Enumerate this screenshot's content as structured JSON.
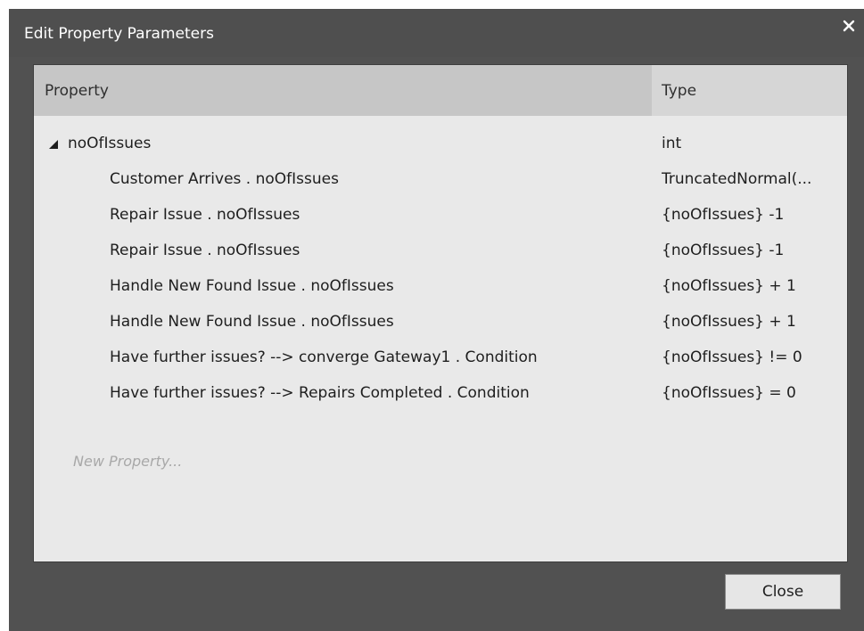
{
  "window": {
    "title": "Edit Property Parameters",
    "close_icon": "close-icon"
  },
  "grid": {
    "columns": {
      "property": "Property",
      "type": "Type"
    },
    "parent_row": {
      "property": "noOfIssues",
      "type": "int",
      "expander_icon": "collapse-triangle-icon",
      "expanded": true
    },
    "rows": [
      {
        "property": "Customer Arrives . noOfIssues",
        "type": "TruncatedNormal(..."
      },
      {
        "property": "Repair Issue . noOfIssues",
        "type": "{noOfIssues} -1"
      },
      {
        "property": "Repair Issue . noOfIssues",
        "type": "{noOfIssues} -1"
      },
      {
        "property": "Handle New Found Issue . noOfIssues",
        "type": "{noOfIssues} + 1"
      },
      {
        "property": "Handle New Found Issue . noOfIssues",
        "type": "{noOfIssues} + 1"
      },
      {
        "property": "Have further issues? --> converge Gateway1 . Condition",
        "type": "{noOfIssues} != 0"
      },
      {
        "property": "Have further issues? --> Repairs Completed . Condition",
        "type": "{noOfIssues} = 0"
      }
    ],
    "new_property_placeholder": "New Property..."
  },
  "footer": {
    "close_label": "Close"
  }
}
